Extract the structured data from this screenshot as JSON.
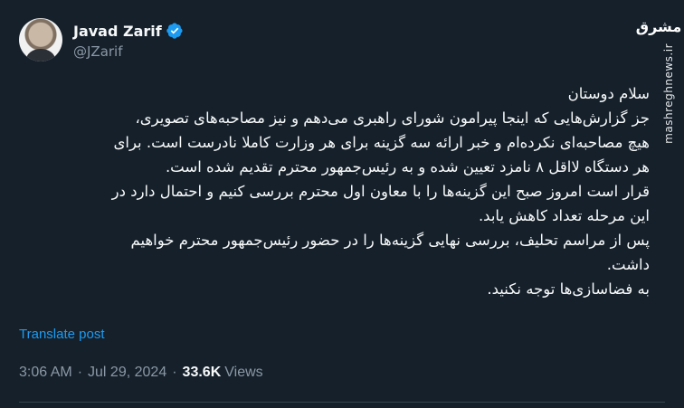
{
  "author": {
    "display_name": "Javad Zarif",
    "handle": "@JZarif",
    "verified_icon": "verified-badge-icon",
    "verified_color": "#1d9bf0"
  },
  "watermark": {
    "logo_text": "مشرق",
    "site": "mashreghnews.ir"
  },
  "post": {
    "lines": [
      "سلام دوستان",
      "جز گزارش‌هایی که اینجا پیرامون شورای راهبری می‌دهم و نیز مصاحبه‌های تصویری،",
      "هیچ مصاحبه‌ای نکرده‌ام و خبر ارائه سه گزینه برای هر وزارت کاملا نادرست است. برای",
      "هر دستگاه لااقل ۸ نامزد تعیین شده و به رئیس‌جمهور محترم تقدیم شده است.",
      "قرار است امروز صبح این گزینه‌ها را با معاون اول محترم بررسی کنیم و احتمال دارد در",
      "این مرحله تعداد کاهش یابد.",
      "پس از مراسم تحلیف، بررسی نهایی گزینه‌ها را در حضور رئیس‌جمهور محترم خواهیم",
      "داشت.",
      "به فضاسازی‌ها توجه نکنید."
    ],
    "translate_label": "Translate post",
    "time": "3:06 AM",
    "separator": "·",
    "date": "Jul 29, 2024",
    "views_count": "33.6K",
    "views_label": "Views"
  },
  "colors": {
    "background": "#15202b",
    "text": "#f7f9f9",
    "secondary_text": "#8b98a5",
    "link": "#1d9bf0",
    "divider": "#38444d"
  }
}
